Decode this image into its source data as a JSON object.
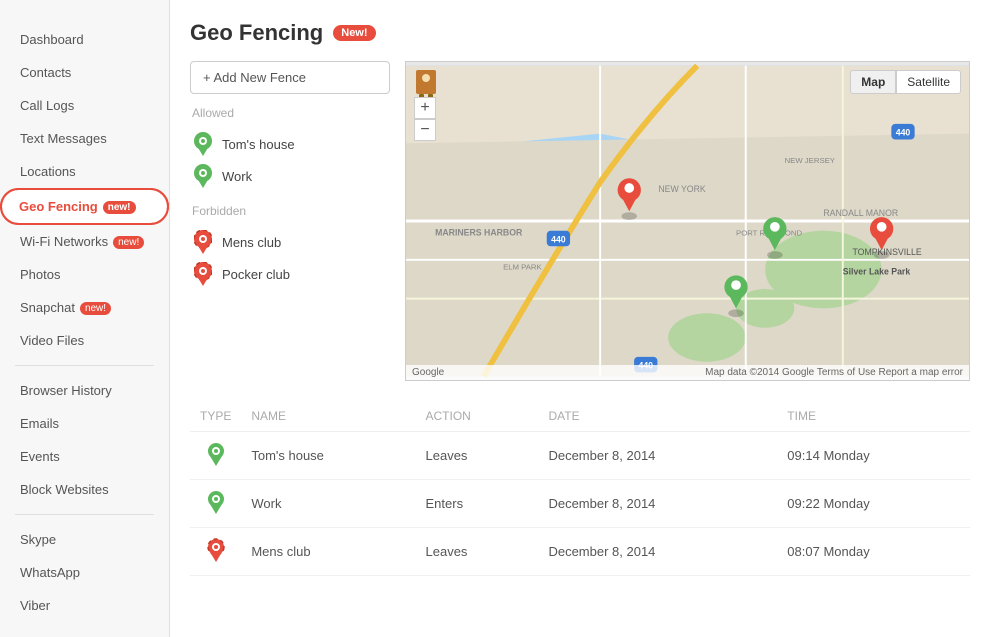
{
  "sidebar": {
    "items": [
      {
        "label": "Dashboard",
        "id": "dashboard",
        "badge": null,
        "active": false
      },
      {
        "label": "Contacts",
        "id": "contacts",
        "badge": null,
        "active": false
      },
      {
        "label": "Call Logs",
        "id": "call-logs",
        "badge": null,
        "active": false
      },
      {
        "label": "Text Messages",
        "id": "text-messages",
        "badge": null,
        "active": false
      },
      {
        "label": "Locations",
        "id": "locations",
        "badge": null,
        "active": false
      },
      {
        "label": "Geo Fencing",
        "id": "geo-fencing",
        "badge": "new!",
        "active": true
      },
      {
        "label": "Wi-Fi Networks",
        "id": "wifi-networks",
        "badge": "new!",
        "active": false
      },
      {
        "label": "Photos",
        "id": "photos",
        "badge": null,
        "active": false
      },
      {
        "label": "Snapchat",
        "id": "snapchat",
        "badge": "new!",
        "active": false
      },
      {
        "label": "Video Files",
        "id": "video-files",
        "badge": null,
        "active": false
      },
      {
        "label": "Browser History",
        "id": "browser-history",
        "badge": null,
        "active": false
      },
      {
        "label": "Emails",
        "id": "emails",
        "badge": null,
        "active": false
      },
      {
        "label": "Events",
        "id": "events",
        "badge": null,
        "active": false
      },
      {
        "label": "Block Websites",
        "id": "block-websites",
        "badge": null,
        "active": false
      },
      {
        "label": "Skype",
        "id": "skype",
        "badge": null,
        "active": false
      },
      {
        "label": "WhatsApp",
        "id": "whatsapp",
        "badge": null,
        "active": false
      },
      {
        "label": "Viber",
        "id": "viber",
        "badge": null,
        "active": false
      }
    ]
  },
  "page": {
    "title": "Geo Fencing",
    "badge": "New!"
  },
  "fences": {
    "add_button": "+ Add New Fence",
    "allowed_label": "Allowed",
    "forbidden_label": "Forbidden",
    "allowed_items": [
      {
        "name": "Tom's house"
      },
      {
        "name": "Work"
      }
    ],
    "forbidden_items": [
      {
        "name": "Mens club"
      },
      {
        "name": "Pocker club"
      }
    ]
  },
  "map": {
    "map_btn": "Map",
    "satellite_btn": "Satellite",
    "zoom_in": "+",
    "zoom_out": "−",
    "footer_left": "Google",
    "footer_right": "Map data ©2014 Google   Terms of Use   Report a map error"
  },
  "table": {
    "columns": [
      "TYPE",
      "NAME",
      "ACTION",
      "DATE",
      "TIME"
    ],
    "rows": [
      {
        "type": "allowed",
        "name": "Tom's house",
        "action": "Leaves",
        "date": "December 8, 2014",
        "time": "09:14 Monday"
      },
      {
        "type": "allowed",
        "name": "Work",
        "action": "Enters",
        "date": "December 8, 2014",
        "time": "09:22 Monday"
      },
      {
        "type": "forbidden",
        "name": "Mens club",
        "action": "Leaves",
        "date": "December 8, 2014",
        "time": "08:07 Monday"
      }
    ]
  }
}
